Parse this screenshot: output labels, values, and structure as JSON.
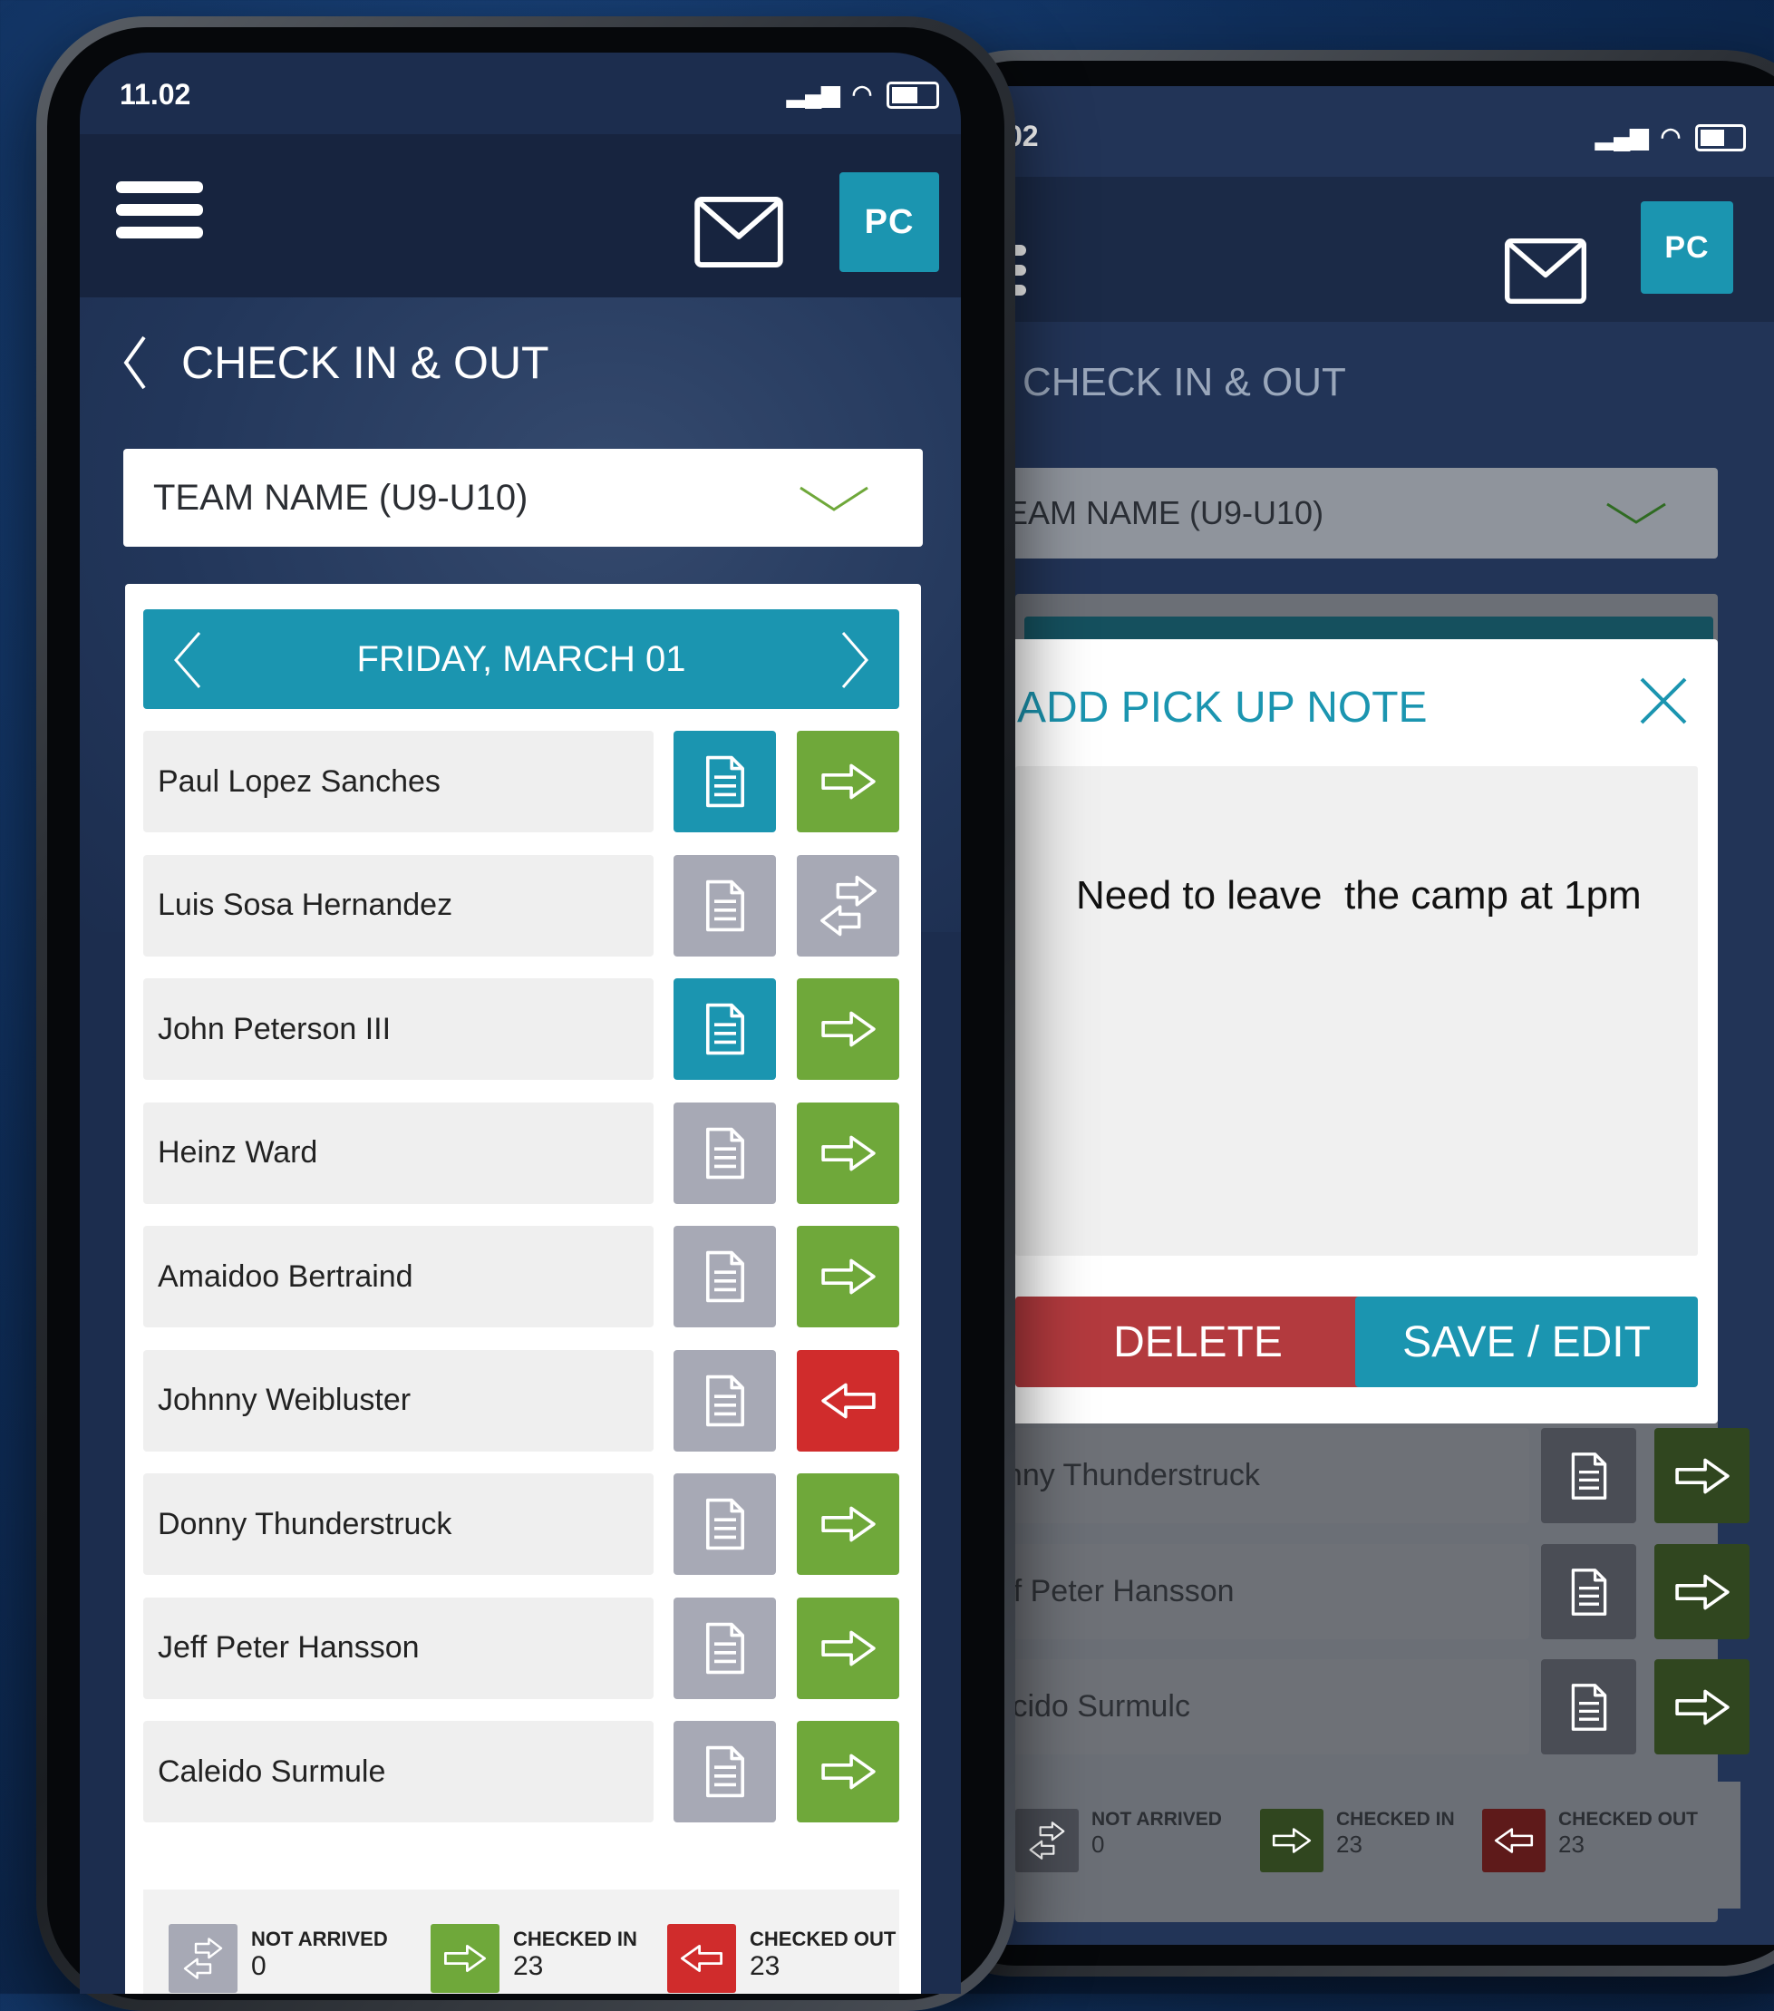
{
  "status": {
    "time_front": "11.02",
    "time_back": "02"
  },
  "header": {
    "avatar_initials": "PC"
  },
  "page": {
    "title": "CHECK IN & OUT"
  },
  "team_select": {
    "value": "TEAM NAME (U9-U10)",
    "value_back": "EAM NAME (U9-U10)"
  },
  "date_nav": {
    "label": "FRIDAY, MARCH 01"
  },
  "players": [
    {
      "name": "Paul Lopez Sanches",
      "note": "teal",
      "status": "checked-in"
    },
    {
      "name": "Luis Sosa Hernandez",
      "note": "grey",
      "status": "not-arrived"
    },
    {
      "name": "John Peterson III",
      "note": "teal",
      "status": "checked-in"
    },
    {
      "name": "Heinz Ward",
      "note": "grey",
      "status": "checked-in"
    },
    {
      "name": "Amaidoo Bertraind",
      "note": "grey",
      "status": "checked-in"
    },
    {
      "name": "Johnny Weibluster",
      "note": "grey",
      "status": "checked-out"
    },
    {
      "name": "Donny Thunderstruck",
      "note": "grey",
      "status": "checked-in"
    },
    {
      "name": "Jeff Peter Hansson",
      "note": "grey",
      "status": "checked-in"
    },
    {
      "name": "Caleido Surmule",
      "note": "grey",
      "status": "checked-in"
    }
  ],
  "back_players": [
    {
      "name": "onny Thunderstruck"
    },
    {
      "name": "eff Peter Hansson"
    },
    {
      "name": "alcido Surmulc"
    }
  ],
  "legend": {
    "not_arrived": {
      "label": "NOT ARRIVED",
      "value": "0"
    },
    "checked_in": {
      "label": "CHECKED IN",
      "value": "23"
    },
    "checked_out": {
      "label": "CHECKED OUT",
      "value": "23"
    }
  },
  "modal": {
    "title": "ADD PICK UP NOTE",
    "note_text": "Need to leave  the camp at 1pm",
    "delete_label": "DELETE",
    "save_label": "SAVE / EDIT"
  },
  "colors": {
    "teal": "#1b95b0",
    "green": "#6fa83a",
    "red": "#d02c2c",
    "grey": "#a7a9b5",
    "navy": "#1c2d4e"
  }
}
